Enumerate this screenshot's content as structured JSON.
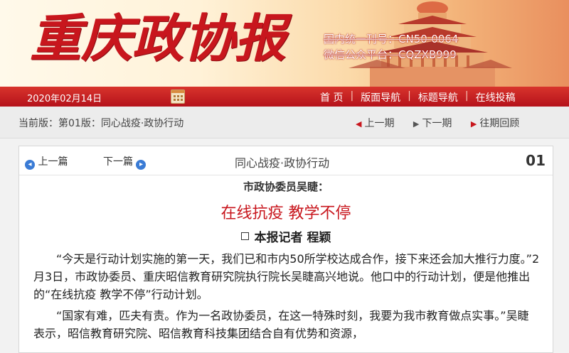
{
  "masthead": {
    "brand": "重庆政协报",
    "registration": [
      "国内统一刊号：CN50-0064",
      "微信公众平台：CQZXB999"
    ]
  },
  "navbar": {
    "date": "2020年02月14日",
    "links": [
      "首 页",
      "版面导航",
      "标题导航",
      "在线投稿"
    ]
  },
  "edition": {
    "current": "当前版：第01版：同心战疫·政协行动",
    "prev_issue": "上一期",
    "next_issue": "下一期",
    "archive": "往期回顾"
  },
  "article": {
    "prev_article": "上一篇",
    "next_article": "下一篇",
    "section": "同心战疫·政协行动",
    "page_number": "01",
    "kicker": "市政协委员吴睫：",
    "headline": "在线抗疫 教学不停",
    "byline": "本报记者 程颖",
    "paragraphs": [
      "“今天是行动计划实施的第一天，我们已和市内50所学校达成合作，接下来还会加大推行力度。”2月3日，市政协委员、重庆昭信教育研究院执行院长吴睫高兴地说。他口中的行动计划，便是他推出的“在线抗疫 教学不停”行动计划。",
      "“国家有难，匹夫有责。作为一名政协委员，在这一特殊时刻，我要为我市教育做点实事。”吴睫表示，昭信教育研究院、昭信教育科技集团结合自有优势和资源，"
    ]
  },
  "colors": {
    "brand_red": "#c8161d",
    "nav_red": "#b5121b",
    "link_blue": "#3a7bd5"
  }
}
